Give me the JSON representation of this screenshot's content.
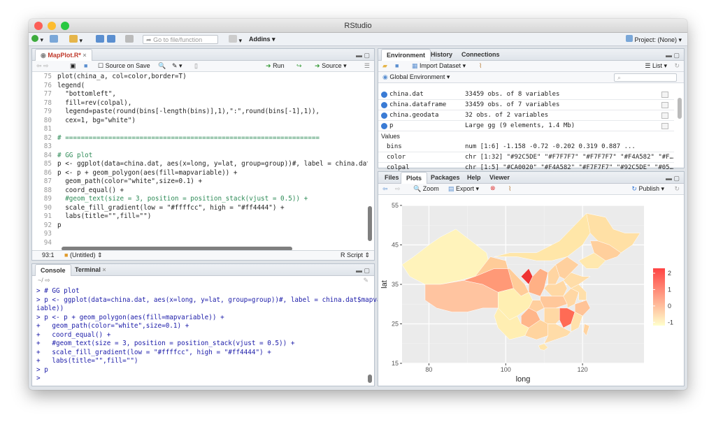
{
  "window": {
    "title": "RStudio"
  },
  "toolbar": {
    "goto_placeholder": "Go to file/function",
    "addins": "Addins",
    "project": "Project: (None)"
  },
  "editor": {
    "tab": "MapPlot.R*",
    "source_on_save": "Source on Save",
    "run": "Run",
    "source": "Source",
    "lines": [
      {
        "n": "75",
        "t": "plot(china_a, col=color,border=T)"
      },
      {
        "n": "76",
        "t": "legend("
      },
      {
        "n": "77",
        "t": "  \"bottomleft\","
      },
      {
        "n": "78",
        "t": "  fill=rev(colpal),"
      },
      {
        "n": "79",
        "t": "  legend=paste(round(bins[-length(bins)],1),\":\",round(bins[-1],1)),"
      },
      {
        "n": "80",
        "t": "  cex=1, bg=\"white\")"
      },
      {
        "n": "81",
        "t": ""
      },
      {
        "n": "82",
        "t": "# ================================================================="
      },
      {
        "n": "83",
        "t": ""
      },
      {
        "n": "84",
        "t": "# GG plot"
      },
      {
        "n": "85",
        "t": "p <- ggplot(data=china.dat, aes(x=long, y=lat, group=group))#, label = china.dat$ma"
      },
      {
        "n": "86",
        "t": "p <- p + geom_polygon(aes(fill=mapvariable)) +"
      },
      {
        "n": "87",
        "t": "  geom_path(color=\"white\",size=0.1) +"
      },
      {
        "n": "88",
        "t": "  coord_equal() +"
      },
      {
        "n": "89",
        "t": "  #geom_text(size = 3, position = position_stack(vjust = 0.5)) +"
      },
      {
        "n": "90",
        "t": "  scale_fill_gradient(low = \"#ffffcc\", high = \"#ff4444\") +"
      },
      {
        "n": "91",
        "t": "  labs(title=\"\",fill=\"\")"
      },
      {
        "n": "92",
        "t": "p"
      },
      {
        "n": "93",
        "t": ""
      },
      {
        "n": "94",
        "t": ""
      }
    ],
    "status_pos": "93:1",
    "status_scope": "(Untitled)",
    "status_type": "R Script"
  },
  "console": {
    "tab_console": "Console",
    "tab_terminal": "Terminal",
    "path": "~/",
    "lines": [
      "> # GG plot",
      "> p <- ggplot(data=china.dat, aes(x=long, y=lat, group=group))#, label = china.dat$mapvar",
      "iable))",
      "> p <- p + geom_polygon(aes(fill=mapvariable)) +",
      "+   geom_path(color=\"white\",size=0.1) +",
      "+   coord_equal() +",
      "+   #geom_text(size = 3, position = position_stack(vjust = 0.5)) +",
      "+   scale_fill_gradient(low = \"#ffffcc\", high = \"#ff4444\") +",
      "+   labs(title=\"\",fill=\"\")",
      "> p",
      ">"
    ]
  },
  "environment": {
    "tabs": [
      "Environment",
      "History",
      "Connections"
    ],
    "import": "Import Dataset",
    "list": "List",
    "scope": "Global Environment",
    "data": [
      {
        "name": "china.dat",
        "value": "33459 obs. of 8 variables"
      },
      {
        "name": "china.dataframe",
        "value": "33459 obs. of 7 variables"
      },
      {
        "name": "china.geodata",
        "value": "32 obs. of 2 variables"
      },
      {
        "name": "p",
        "value": "Large gg (9 elements, 1.4 Mb)"
      }
    ],
    "values_header": "Values",
    "values": [
      {
        "name": "bins",
        "value": "num [1:6] -1.158 -0.72 -0.202 0.319 0.887 ..."
      },
      {
        "name": "color",
        "value": "chr [1:32] \"#92C5DE\" \"#F7F7F7\" \"#F7F7F7\" \"#F4A582\" \"#F…"
      },
      {
        "name": "colpal",
        "value": "chr [1:5] \"#CA0020\" \"#F4A582\" \"#F7F7F7\" \"#92C5DE\" \"#05…"
      }
    ]
  },
  "plots": {
    "tabs": [
      "Files",
      "Plots",
      "Packages",
      "Help",
      "Viewer"
    ],
    "zoom": "Zoom",
    "export": "Export",
    "publish": "Publish"
  },
  "chart_data": {
    "type": "choropleth",
    "xlabel": "long",
    "ylabel": "lat",
    "xticks": [
      80,
      100,
      120
    ],
    "yticks": [
      55,
      45,
      35,
      25,
      15
    ],
    "xlim": [
      73,
      136
    ],
    "ylim": [
      15,
      55
    ],
    "legend": {
      "ticks": [
        2,
        1,
        0,
        -1
      ],
      "low_color": "#ffffcc",
      "high_color": "#ff4444",
      "position": "right"
    }
  }
}
